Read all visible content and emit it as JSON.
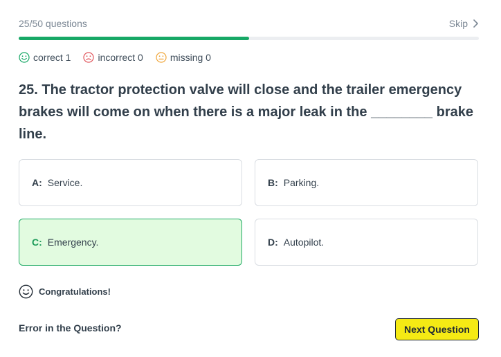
{
  "header": {
    "progress_label": "25/50 questions",
    "progress_fraction": 0.5,
    "skip_label": "Skip"
  },
  "stats": {
    "correct_label": "correct 1",
    "incorrect_label": "incorrect 0",
    "missing_label": "missing 0"
  },
  "question": {
    "text": "25. The tractor protection valve will close and the trailer emergency brakes will come on when there is a major leak in the ________ brake line."
  },
  "options": [
    {
      "letter": "A:",
      "text": "Service.",
      "state": "default"
    },
    {
      "letter": "B:",
      "text": "Parking.",
      "state": "default"
    },
    {
      "letter": "C:",
      "text": "Emergency.",
      "state": "correct"
    },
    {
      "letter": "D:",
      "text": "Autopilot.",
      "state": "default"
    }
  ],
  "result": {
    "message": "Congratulations!"
  },
  "footer": {
    "error_label": "Error in the Question?",
    "next_label": "Next Question"
  },
  "colors": {
    "accent_green": "#17a866",
    "correct_bg": "#e2fbe0",
    "incorrect_red": "#e0535a",
    "missing_orange": "#f0a63a",
    "button_yellow": "#f5ea14"
  }
}
